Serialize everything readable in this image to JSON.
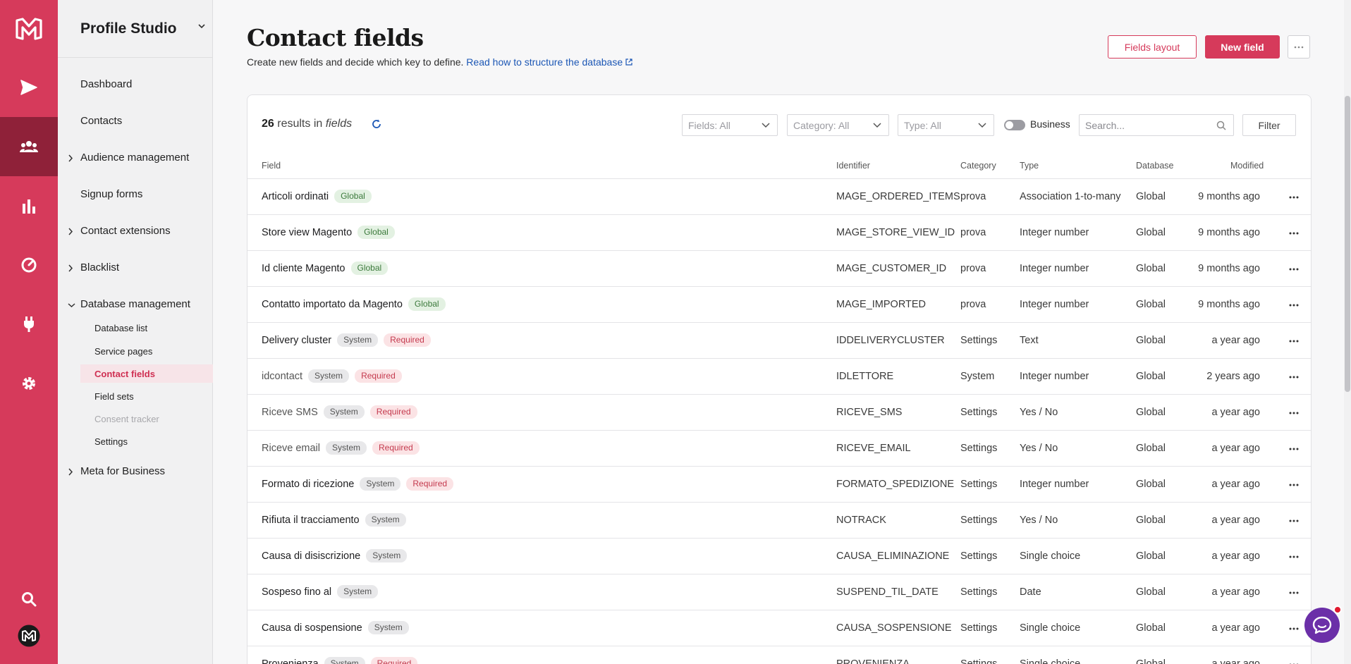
{
  "app": {
    "workspace": "Profile Studio"
  },
  "rail": {
    "items": [
      "logo-icon",
      "send-icon",
      "contacts-icon",
      "chart-icon",
      "gauge-icon",
      "plug-icon",
      "gear-icon",
      "search-icon",
      "user-avatar"
    ]
  },
  "sidebar": {
    "items": [
      {
        "label": "Dashboard"
      },
      {
        "label": "Contacts"
      },
      {
        "label": "Audience management"
      },
      {
        "label": "Signup forms"
      },
      {
        "label": "Contact extensions"
      },
      {
        "label": "Blacklist"
      },
      {
        "label": "Database management"
      },
      {
        "label": "Meta for Business"
      }
    ],
    "subitems": [
      {
        "label": "Database list"
      },
      {
        "label": "Service pages"
      },
      {
        "label": "Contact fields"
      },
      {
        "label": "Field sets"
      },
      {
        "label": "Consent tracker"
      },
      {
        "label": "Settings"
      }
    ]
  },
  "header": {
    "title": "Contact fields",
    "subtitle": "Create new fields and decide which key to define.",
    "link": "Read how to structure the database",
    "fields_layout_label": "Fields layout",
    "new_field_label": "New field"
  },
  "toolbar": {
    "count": "26",
    "results_in": "results in",
    "entity": "fields",
    "fields_filter": "Fields: All",
    "category_filter": "Category: All",
    "type_filter": "Type: All",
    "business_label": "Business",
    "search_placeholder": "Search...",
    "filter_label": "Filter"
  },
  "table": {
    "headers": {
      "field": "Field",
      "identifier": "Identifier",
      "category": "Category",
      "type": "Type",
      "database": "Database",
      "modified": "Modified"
    },
    "rows": [
      {
        "name": "Articoli ordinati",
        "badges": [
          "Global"
        ],
        "identifier": "MAGE_ORDERED_ITEMS",
        "category": "prova",
        "type": "Association 1-to-many",
        "database": "Global",
        "modified": "9 months ago"
      },
      {
        "name": "Store view Magento",
        "badges": [
          "Global"
        ],
        "identifier": "MAGE_STORE_VIEW_ID",
        "category": "prova",
        "type": "Integer number",
        "database": "Global",
        "modified": "9 months ago"
      },
      {
        "name": "Id cliente Magento",
        "badges": [
          "Global"
        ],
        "identifier": "MAGE_CUSTOMER_ID",
        "category": "prova",
        "type": "Integer number",
        "database": "Global",
        "modified": "9 months ago"
      },
      {
        "name": "Contatto importato da Magento",
        "badges": [
          "Global"
        ],
        "identifier": "MAGE_IMPORTED",
        "category": "prova",
        "type": "Integer number",
        "database": "Global",
        "modified": "9 months ago"
      },
      {
        "name": "Delivery cluster",
        "badges": [
          "System",
          "Required"
        ],
        "identifier": "IDDELIVERYCLUSTER",
        "category": "Settings",
        "type": "Text",
        "database": "Global",
        "modified": "a year ago"
      },
      {
        "name": "idcontact",
        "badges": [
          "System",
          "Required"
        ],
        "identifier": "IDLETTORE",
        "category": "System",
        "type": "Integer number",
        "database": "Global",
        "modified": "2 years ago",
        "muted": true
      },
      {
        "name": "Riceve SMS",
        "badges": [
          "System",
          "Required"
        ],
        "identifier": "RICEVE_SMS",
        "category": "Settings",
        "type": "Yes / No",
        "database": "Global",
        "modified": "a year ago",
        "muted": true
      },
      {
        "name": "Riceve email",
        "badges": [
          "System",
          "Required"
        ],
        "identifier": "RICEVE_EMAIL",
        "category": "Settings",
        "type": "Yes / No",
        "database": "Global",
        "modified": "a year ago",
        "muted": true
      },
      {
        "name": "Formato di ricezione",
        "badges": [
          "System",
          "Required"
        ],
        "identifier": "FORMATO_SPEDIZIONE",
        "category": "Settings",
        "type": "Integer number",
        "database": "Global",
        "modified": "a year ago"
      },
      {
        "name": "Rifiuta il tracciamento",
        "badges": [
          "System"
        ],
        "identifier": "NOTRACK",
        "category": "Settings",
        "type": "Yes / No",
        "database": "Global",
        "modified": "a year ago"
      },
      {
        "name": "Causa di disiscrizione",
        "badges": [
          "System"
        ],
        "identifier": "CAUSA_ELIMINAZIONE",
        "category": "Settings",
        "type": "Single choice",
        "database": "Global",
        "modified": "a year ago"
      },
      {
        "name": "Sospeso fino al",
        "badges": [
          "System"
        ],
        "identifier": "SUSPEND_TIL_DATE",
        "category": "Settings",
        "type": "Date",
        "database": "Global",
        "modified": "a year ago"
      },
      {
        "name": "Causa di sospensione",
        "badges": [
          "System"
        ],
        "identifier": "CAUSA_SOSPENSIONE",
        "category": "Settings",
        "type": "Single choice",
        "database": "Global",
        "modified": "a year ago"
      },
      {
        "name": "Provenienza",
        "badges": [
          "System",
          "Required"
        ],
        "identifier": "PROVENIENZA",
        "category": "Settings",
        "type": "Single choice",
        "database": "Global",
        "modified": "a year ago"
      }
    ]
  },
  "colors": {
    "brand": "#d63a5b",
    "brand_dark": "#8f2139",
    "link": "#1c57b5"
  }
}
